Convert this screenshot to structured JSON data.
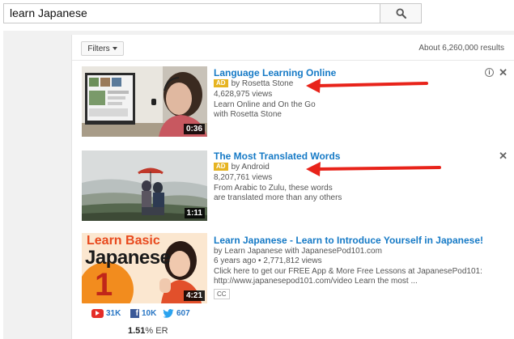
{
  "search": {
    "query": "learn Japanese",
    "icon": "search-icon"
  },
  "toolbar": {
    "filters_label": "Filters",
    "result_count": "About 6,260,000 results"
  },
  "results": [
    {
      "title": "Language Learning Online",
      "ad_label": "AD",
      "channel": "by Rosetta Stone",
      "views": "4,628,975 views",
      "desc1": "Learn Online and On the Go",
      "desc2": "with Rosetta Stone",
      "duration": "0:36",
      "info_icon": "i",
      "close_icon": "✕"
    },
    {
      "title": "The Most Translated Words",
      "ad_label": "AD",
      "channel": "by Android",
      "views": "8,207,761 views",
      "desc1": "From Arabic to Zulu, these words",
      "desc2": "are translated more than any others",
      "duration": "1:11",
      "close_icon": "✕"
    },
    {
      "title": "Learn Japanese - Learn to Introduce Yourself in Japanese!",
      "channel": "by Learn Japanese with JapanesePod101.com",
      "age_views": "6 years ago • 2,771,812 views",
      "desc1": "Click here to get our FREE App & More Free Lessons at JapanesePod101:",
      "desc2": "http://www.japanesepod101.com/video Learn the most ...",
      "duration": "4:21",
      "cc_label": "CC",
      "thumb_text1": "Learn Basic",
      "thumb_text2": "Japanese",
      "thumb_num": "1"
    }
  ],
  "social": {
    "youtube": "31K",
    "facebook": "10K",
    "twitter": "607",
    "fb_glyph": "f"
  },
  "engagement": {
    "value": "1.51",
    "unit": "% ER"
  },
  "colors": {
    "title_link": "#167ac6",
    "ad_badge": "#e6b422",
    "arrow": "#e8231a",
    "social_text": "#2a77c5"
  }
}
